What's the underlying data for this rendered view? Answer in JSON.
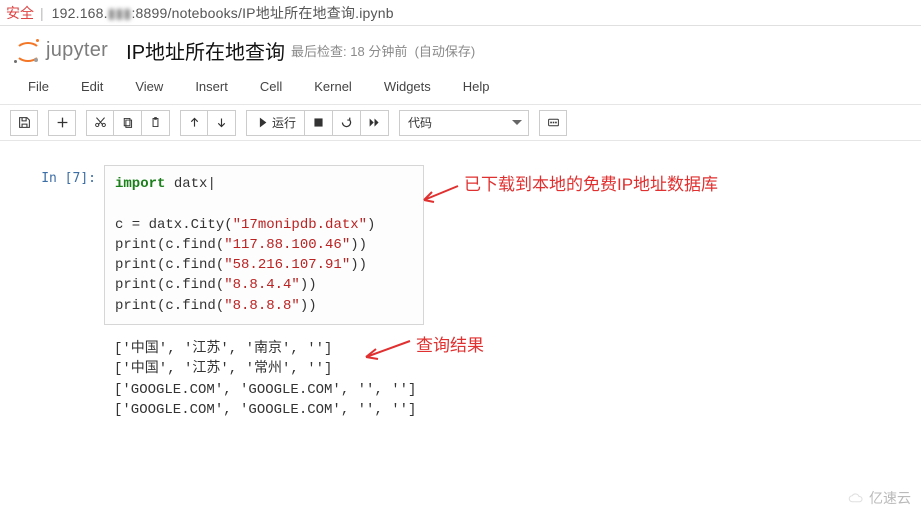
{
  "addr": {
    "prefix": "安全",
    "sep": "|",
    "host_left": "192.168.",
    "host_blur": "▮▮▮",
    "host_right": ":8899/notebooks/IP地址所在地查询.ipynb"
  },
  "header": {
    "logo_text": "jupyter",
    "title": "IP地址所在地查询",
    "last_check_prefix": "最后检查: ",
    "last_check_time": "18 分钟前",
    "autosave": "(自动保存)"
  },
  "menu": {
    "file": "File",
    "edit": "Edit",
    "view": "View",
    "insert": "Insert",
    "cell": "Cell",
    "kernel": "Kernel",
    "widgets": "Widgets",
    "help": "Help"
  },
  "toolbar": {
    "run_label": "运行",
    "cell_type": "代码"
  },
  "cell": {
    "prompt": "In [7]:",
    "code": {
      "l1_kw": "import",
      "l1_rest": " datx",
      "l3_a": "c = datx.City(",
      "l3_s": "\"17monipdb.datx\"",
      "l3_b": ")",
      "l4_a": "print(c.find(",
      "l4_s": "\"117.88.100.46\"",
      "l4_b": "))",
      "l5_a": "print(c.find(",
      "l5_s": "\"58.216.107.91\"",
      "l5_b": "))",
      "l6_a": "print(c.find(",
      "l6_s": "\"8.8.4.4\"",
      "l6_b": "))",
      "l7_a": "print(c.find(",
      "l7_s": "\"8.8.8.8\"",
      "l7_b": "))"
    },
    "output": {
      "o1": "['中国', '江苏', '南京', '']",
      "o2": "['中国', '江苏', '常州', '']",
      "o3": "['GOOGLE.COM', 'GOOGLE.COM', '', '']",
      "o4": "['GOOGLE.COM', 'GOOGLE.COM', '', '']"
    }
  },
  "annot": {
    "db": "已下载到本地的免费IP地址数据库",
    "result": "查询结果"
  },
  "watermark": "亿速云"
}
